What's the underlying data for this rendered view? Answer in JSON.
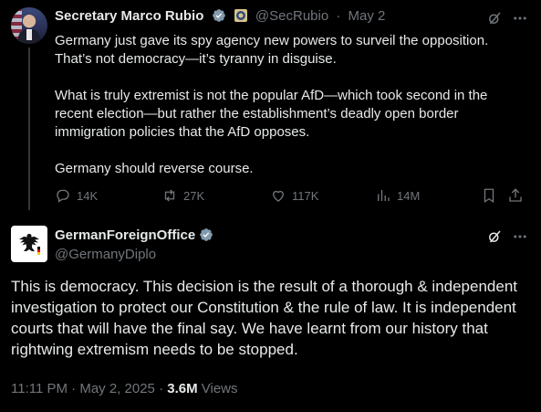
{
  "tweet1": {
    "author_name": "Secretary Marco Rubio",
    "handle": "@SecRubio",
    "separator": "·",
    "date": "May 2",
    "paragraphs": [
      "Germany just gave its spy agency new powers to surveil the opposition. That’s not democracy—it’s tyranny in disguise.",
      "What is truly extremist is not the popular AfD—which took second in the recent election—but rather the establishment’s deadly open border immigration policies that the AfD opposes.",
      "Germany should reverse course."
    ],
    "replies": "14K",
    "reposts": "27K",
    "likes": "117K",
    "views": "14M"
  },
  "tweet2": {
    "author_name": "GermanForeignOffice",
    "handle": "@GermanyDiplo",
    "text": "This is democracy. This decision is the result of a thorough & independent investigation to protect our Constitution & the rule of law. It is independent courts that will have the final say. We have learnt from our history that rightwing extremism needs to be stopped.",
    "time": "11:11 PM",
    "separator": "·",
    "date": "May 2, 2025",
    "separator2": "·",
    "views_count": "3.6M",
    "views_label": "Views"
  },
  "colors": {
    "background": "#000000",
    "text": "#e7e9ea",
    "muted": "#71767b",
    "verified_blue": "#1d9bf0",
    "verified_gray": "#829aab"
  },
  "icons": [
    "more-icon",
    "grok-icon",
    "reply-icon",
    "repost-icon",
    "like-icon",
    "views-icon",
    "bookmark-icon",
    "share-icon",
    "verified-badge-icon",
    "government-seal-icon",
    "german-eagle-icon"
  ]
}
